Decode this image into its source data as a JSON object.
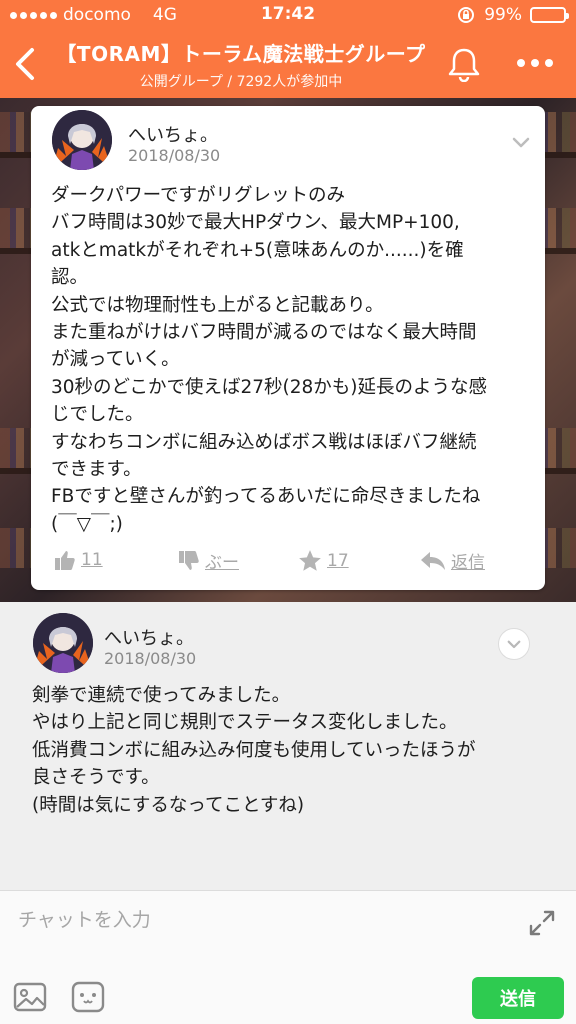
{
  "status_bar": {
    "carrier": "docomo",
    "network": "4G",
    "time": "17:42",
    "battery": "99%",
    "battery_level": 0.99
  },
  "header": {
    "title": "【TORAM】トーラム魔法戦士グループ",
    "subtitle": "公開グループ / 7292人が参加中",
    "back_icon": "chevron-left-icon",
    "bell_icon": "bell-icon",
    "more_icon": "more-dots-icon"
  },
  "post": {
    "author": "へいちょ。",
    "date": "2018/08/30",
    "lines": [
      "ダークパワーですがリグレットのみ",
      "バフ時間は30妙で最大HPダウン、最大MP+100,",
      "atkとmatkがそれぞれ+5(意味あんのか......)を確",
      "認。",
      "公式では物理耐性も上がると記載あり。",
      "また重ねがけはバフ時間が減るのではなく最大時間",
      "が減っていく。",
      "30秒のどこかで使えば27秒(28かも)延長のような感",
      "じでした。",
      "すなわちコンボに組み込めばボス戦はほぼバフ継続",
      "できます。",
      "FBですと壁さんが釣ってるあいだに命尽きましたね",
      "(￣▽￣;)"
    ],
    "actions": {
      "like_count": "11",
      "dislike_label": "ぶー",
      "star_count": "17",
      "reply_label": "返信"
    }
  },
  "comment": {
    "author": "へいちょ。",
    "date": "2018/08/30",
    "lines": [
      "剣拳で連続で使ってみました。",
      "やはり上記と同じ規則でステータス変化しました。",
      "低消費コンボに組み込み何度も使用していったほうが",
      "良さそうです。",
      "(時間は気にするなってことすね)"
    ]
  },
  "input_bar": {
    "placeholder": "チャットを入力",
    "send_label": "送信"
  },
  "colors": {
    "header": "#fb7740",
    "send": "#2ecb50",
    "action": "#a8a8a8"
  }
}
